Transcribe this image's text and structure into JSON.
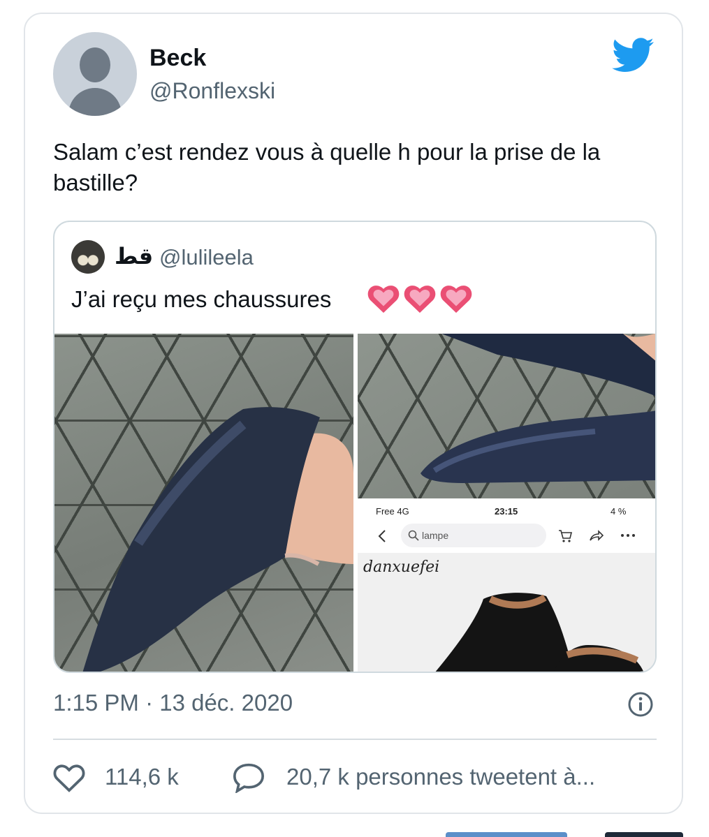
{
  "tweet": {
    "display_name": "Beck",
    "handle": "@Ronflexski",
    "text": "Salam c’est rendez vous à quelle h pour la prise de la bastille?",
    "timestamp": "1:15 PM · 13 déc. 2020",
    "likes": "114,6 k",
    "retweets_text": "20,7 k personnes tweetent à..."
  },
  "quoted": {
    "display_name": "قط",
    "handle": "@lulileela",
    "text": "J’ai reçu mes chaussures",
    "emoji": [
      "💗",
      "💗",
      "💗"
    ],
    "screenshot": {
      "carrier": "Free 4G",
      "time": "23:15",
      "battery": "4 %",
      "search_placeholder": "lampe",
      "brand": "danxuefei"
    }
  },
  "colors": {
    "twitter_blue": "#1d9bf0",
    "secondary_text": "#536471",
    "border": "#cfd9de"
  },
  "icons": {
    "brand": "twitter-bird-icon",
    "info": "info-icon",
    "like": "heart-outline-icon",
    "reply": "speech-bubble-icon"
  }
}
